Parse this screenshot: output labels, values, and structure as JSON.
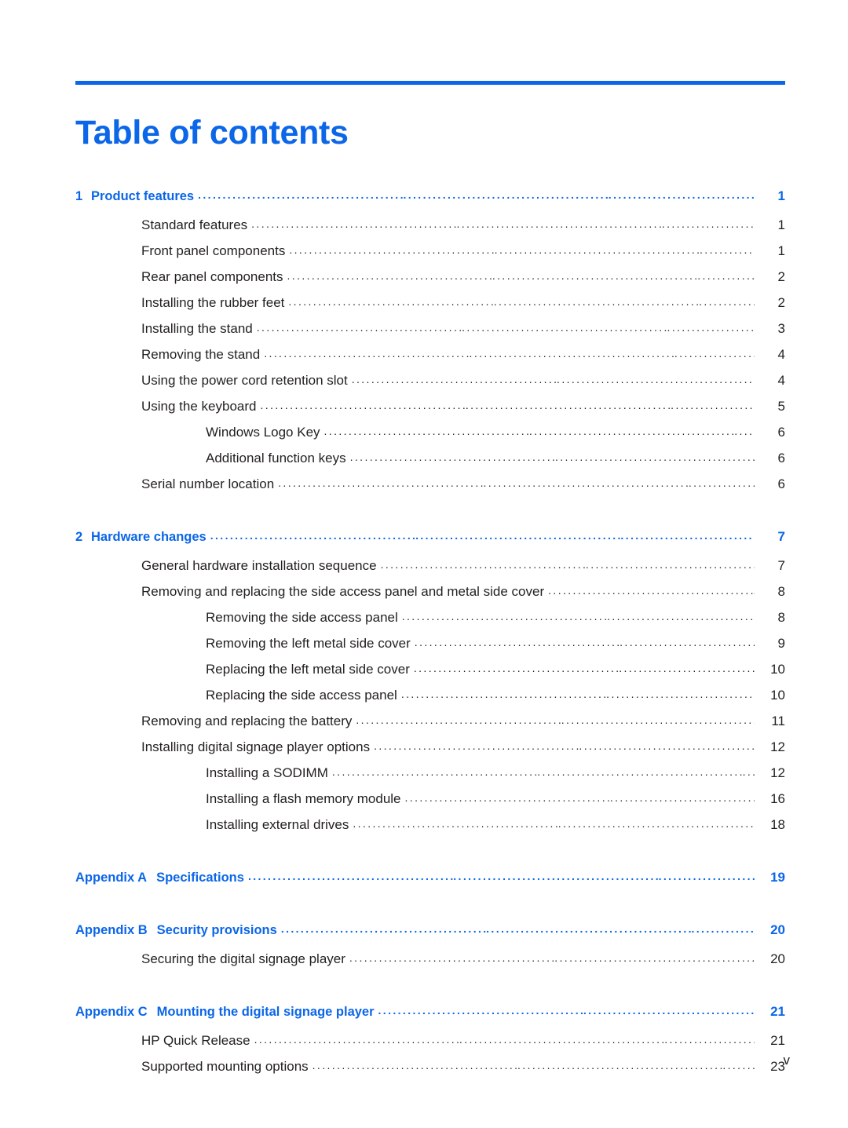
{
  "document": {
    "title": "Table of contents",
    "footer_page_number": "v",
    "accent_color": "#0B66E8",
    "text_color": "#231F20"
  },
  "toc": {
    "entries": [
      {
        "level": 1,
        "number": "1",
        "label": "Product features",
        "page": "1"
      },
      {
        "level": 2,
        "label": "Standard features",
        "page": "1"
      },
      {
        "level": 2,
        "label": "Front panel components",
        "page": "1"
      },
      {
        "level": 2,
        "label": "Rear panel components",
        "page": "2"
      },
      {
        "level": 2,
        "label": "Installing the rubber feet",
        "page": "2"
      },
      {
        "level": 2,
        "label": "Installing the stand",
        "page": "3"
      },
      {
        "level": 2,
        "label": "Removing the stand",
        "page": "4"
      },
      {
        "level": 2,
        "label": "Using the power cord retention slot",
        "page": "4"
      },
      {
        "level": 2,
        "label": "Using the keyboard",
        "page": "5"
      },
      {
        "level": 3,
        "label": "Windows Logo Key",
        "page": "6"
      },
      {
        "level": 3,
        "label": "Additional function keys",
        "page": "6"
      },
      {
        "level": 2,
        "label": "Serial number location",
        "page": "6"
      },
      {
        "level": 1,
        "number": "2",
        "label": "Hardware changes",
        "page": "7"
      },
      {
        "level": 2,
        "label": "General hardware installation sequence",
        "page": "7"
      },
      {
        "level": 2,
        "label": "Removing and replacing the side access panel and metal side cover",
        "page": "8"
      },
      {
        "level": 3,
        "label": "Removing the side access panel",
        "page": "8"
      },
      {
        "level": 3,
        "label": "Removing the left metal side cover",
        "page": "9"
      },
      {
        "level": 3,
        "label": "Replacing the left metal side cover",
        "page": "10"
      },
      {
        "level": 3,
        "label": "Replacing the side access panel",
        "page": "10"
      },
      {
        "level": 2,
        "label": "Removing and replacing the battery",
        "page": "11"
      },
      {
        "level": 2,
        "label": "Installing digital signage player options",
        "page": "12"
      },
      {
        "level": 3,
        "label": "Installing a SODIMM",
        "page": "12"
      },
      {
        "level": 3,
        "label": "Installing a flash memory module",
        "page": "16"
      },
      {
        "level": 3,
        "label": "Installing external drives",
        "page": "18"
      },
      {
        "level": 1,
        "appendix": "Appendix A",
        "label": "Specifications",
        "page": "19"
      },
      {
        "level": 1,
        "appendix": "Appendix B",
        "label": "Security provisions",
        "page": "20"
      },
      {
        "level": 2,
        "label": "Securing the digital signage player",
        "page": "20"
      },
      {
        "level": 1,
        "appendix": "Appendix C",
        "label": "Mounting the digital signage player",
        "page": "21"
      },
      {
        "level": 2,
        "label": "HP Quick Release",
        "page": "21"
      },
      {
        "level": 2,
        "label": "Supported mounting options",
        "page": "23"
      }
    ]
  }
}
